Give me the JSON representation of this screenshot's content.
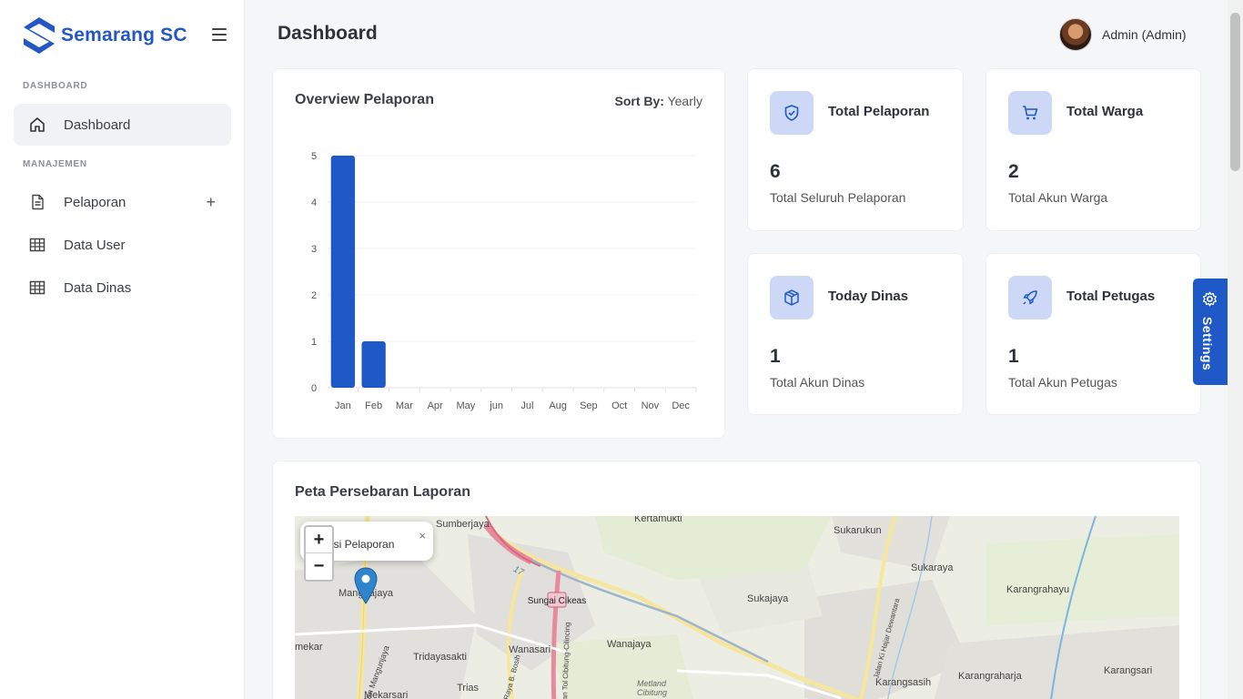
{
  "brand": {
    "name": "Semarang SC"
  },
  "sidebar": {
    "section_dashboard": "DASHBOARD",
    "section_manajemen": "MANAJEMEN",
    "items": [
      {
        "label": "Dashboard",
        "icon": "home-icon",
        "active": true
      },
      {
        "label": "Pelaporan",
        "icon": "document-icon",
        "expandable": true,
        "expand_glyph": "+"
      },
      {
        "label": "Data User",
        "icon": "table-icon"
      },
      {
        "label": "Data Dinas",
        "icon": "table-icon"
      }
    ]
  },
  "header": {
    "title": "Dashboard",
    "user": "Admin (Admin)"
  },
  "overview": {
    "title": "Overview Pelaporan",
    "sort_label": "Sort By:",
    "sort_value": "Yearly"
  },
  "chart_data": {
    "type": "bar",
    "title": "Overview Pelaporan",
    "categories": [
      "Jan",
      "Feb",
      "Mar",
      "Apr",
      "May",
      "jun",
      "Jul",
      "Aug",
      "Sep",
      "Oct",
      "Nov",
      "Dec"
    ],
    "values": [
      5,
      1,
      0,
      0,
      0,
      0,
      0,
      0,
      0,
      0,
      0,
      0
    ],
    "yticks": [
      0,
      1,
      2,
      3,
      4,
      5
    ],
    "ylim": [
      0,
      5
    ],
    "color": "#1f58c7",
    "grid": true
  },
  "stats": [
    {
      "title": "Total Pelaporan",
      "value": "6",
      "desc": "Total Seluruh Pelaporan",
      "icon": "shield-check-icon"
    },
    {
      "title": "Total Warga",
      "value": "2",
      "desc": "Total Akun Warga",
      "icon": "cart-icon"
    },
    {
      "title": "Today Dinas",
      "value": "1",
      "desc": "Total Akun Dinas",
      "icon": "box-icon"
    },
    {
      "title": "Total Petugas",
      "value": "1",
      "desc": "Total Akun Petugas",
      "icon": "rocket-icon"
    }
  ],
  "map": {
    "title": "Peta Persebaran Laporan",
    "zoom_in": "+",
    "zoom_out": "−",
    "popup_text": "kasi Pelaporan",
    "popup_close": "×",
    "labels": [
      "Sumberjaya",
      "Kertamukti",
      "Sukarukun",
      "Sukaraya",
      "Karangrahayu",
      "Sukajaya",
      "Manggajaya",
      "Tridayasakti",
      "Wanasari",
      "Wanajaya",
      "Trias",
      "Mekarsari",
      "Karangsasih",
      "Karangraharja",
      "Karangsari",
      "Metland Cibitung",
      "Sungai Cikeas",
      "17",
      "mekar",
      "Jalan Mangunjaya",
      "Jalan Ki Hajar Dewantara",
      "Jalan Tol Cibitung-Cilincing",
      "Jalan Raya B. Bosih"
    ]
  },
  "settings": {
    "label": "Settings"
  }
}
